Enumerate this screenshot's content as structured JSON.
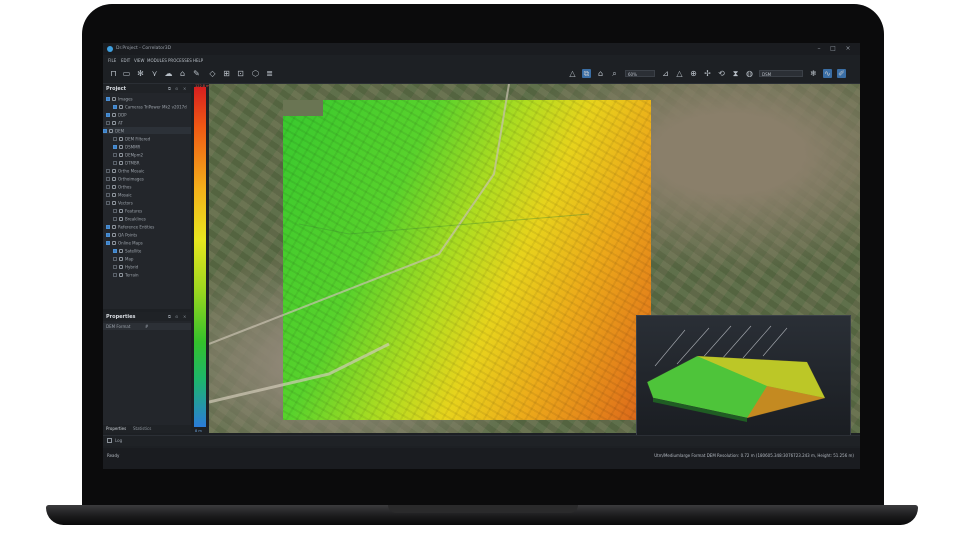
{
  "window": {
    "title": "Dr.Project - Correlator3D"
  },
  "menu": [
    "FILE",
    "EDIT",
    "VIEW",
    "MODULES",
    "PROCESSES",
    "HELP"
  ],
  "toolbar": {
    "zoom_select": "60%",
    "view_select": "DSM"
  },
  "project": {
    "title": "Project",
    "items": [
      {
        "label": "Images",
        "checked": true,
        "indent": 0,
        "icon": "image-icon"
      },
      {
        "label": "Cameras TriPower Mk2 v2017d",
        "checked": true,
        "indent": 1,
        "icon": "camera-icon"
      },
      {
        "label": "DDP",
        "checked": true,
        "indent": 0,
        "icon": "ddp-icon"
      },
      {
        "label": "AT",
        "checked": false,
        "indent": 0,
        "icon": "triangle-icon"
      },
      {
        "label": "DEM",
        "checked": true,
        "indent": 0,
        "icon": "dem-icon",
        "selected": true
      },
      {
        "label": "DEM Filtered",
        "checked": false,
        "indent": 1,
        "icon": "layer-icon"
      },
      {
        "label": "DSMMR",
        "checked": true,
        "indent": 1,
        "icon": "layer-icon"
      },
      {
        "label": "DEMpm2",
        "checked": false,
        "indent": 1,
        "icon": "layer-icon"
      },
      {
        "label": "DTMBR",
        "checked": false,
        "indent": 1,
        "icon": "layer-icon"
      },
      {
        "label": "Ortho Mosaic",
        "checked": false,
        "indent": 0,
        "icon": "mosaic-icon"
      },
      {
        "label": "Orthoimages",
        "checked": false,
        "indent": 0,
        "icon": "ortho-icon"
      },
      {
        "label": "Orthos",
        "checked": false,
        "indent": 0,
        "icon": "ortho-icon"
      },
      {
        "label": "Mosaic",
        "checked": false,
        "indent": 0,
        "icon": "mosaic-icon"
      },
      {
        "label": "Vectors",
        "checked": false,
        "indent": 0,
        "icon": "vector-icon"
      },
      {
        "label": "Features",
        "checked": false,
        "indent": 1,
        "icon": "feature-icon"
      },
      {
        "label": "Breaklines",
        "checked": false,
        "indent": 1,
        "icon": "feature-icon"
      },
      {
        "label": "Reference Entities",
        "checked": true,
        "indent": 0,
        "icon": "reference-icon"
      },
      {
        "label": "QA Points",
        "checked": true,
        "indent": 0,
        "icon": "point-icon"
      },
      {
        "label": "Online Maps",
        "checked": true,
        "indent": 0,
        "icon": "globe-icon"
      },
      {
        "label": "Satellite",
        "checked": true,
        "indent": 1,
        "icon": "satellite-icon"
      },
      {
        "label": "Map",
        "checked": false,
        "indent": 1,
        "icon": "map-icon"
      },
      {
        "label": "Hybrid",
        "checked": false,
        "indent": 1,
        "icon": "hybrid-icon"
      },
      {
        "label": "Terrain",
        "checked": false,
        "indent": 1,
        "icon": "terrain-icon"
      }
    ]
  },
  "properties": {
    "title": "Properties",
    "row": {
      "key": "DEM Format",
      "value": "#"
    },
    "tabs": [
      "Properties",
      "Statistics"
    ]
  },
  "legend": {
    "max": "122.8 m",
    "min": "8 m"
  },
  "log": {
    "label": "Log"
  },
  "status": {
    "left": "Ready",
    "right": "Utm/Mediumlarge Format   DEM Resolution: 0.72 m    (180605.348:3076723.243 m, Height: 51.256 m)"
  }
}
